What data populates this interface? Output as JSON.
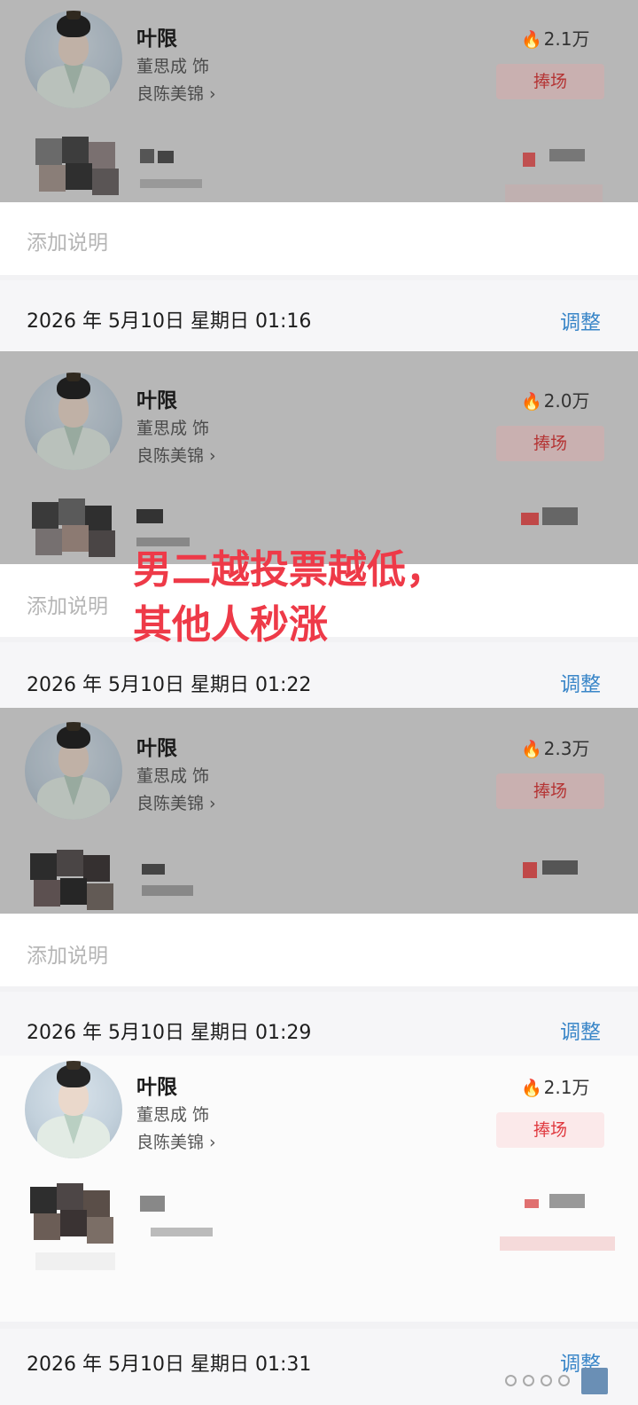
{
  "character": {
    "name": "叶限",
    "actor": "董思成 饰",
    "drama": "良陈美锦"
  },
  "cheer_label": "捧场",
  "note_placeholder": "添加说明",
  "adjust_label": "调整",
  "caption": {
    "line1": "男二越投票越低，",
    "line2": "其他人秒涨"
  },
  "snapshots": [
    {
      "heat": "2.1万"
    },
    {
      "date": "2026 年 5月10日  星期日  01:16",
      "heat": "2.0万"
    },
    {
      "date": "2026 年 5月10日  星期日  01:22",
      "heat": "2.3万"
    },
    {
      "date": "2026 年 5月10日  星期日  01:29",
      "heat": "2.1万"
    },
    {
      "date": "2026 年 5月10日  星期日  01:31"
    }
  ],
  "colors": {
    "caption": "#ee3a48",
    "adjust_link": "#3a86c8",
    "flame": "#e8413c",
    "dim_overlay": "#b7b7b7"
  }
}
